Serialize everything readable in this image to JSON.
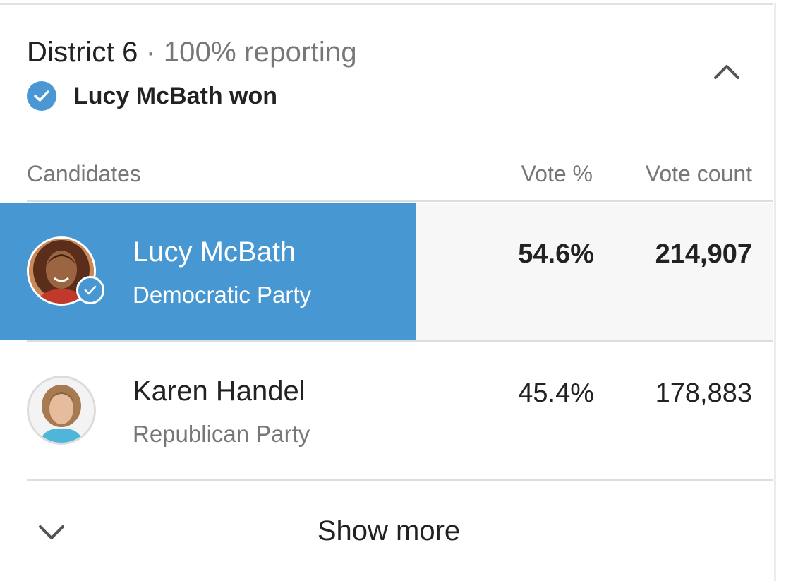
{
  "race": {
    "district": "District 6",
    "separator": " · ",
    "reporting": "100% reporting",
    "winner_text": "Lucy McBath won"
  },
  "columns": {
    "candidates": "Candidates",
    "vote_pct": "Vote %",
    "vote_count": "Vote count"
  },
  "candidates": [
    {
      "name": "Lucy McBath",
      "party": "Democratic Party",
      "vote_pct": "54.6%",
      "vote_count": "214,907",
      "winner": true
    },
    {
      "name": "Karen Handel",
      "party": "Republican Party",
      "vote_pct": "45.4%",
      "vote_count": "178,883",
      "winner": false
    }
  ],
  "footer": {
    "show_more_label": "Show more"
  },
  "icons": {
    "collapse": "chevron-up-icon",
    "expand": "chevron-down-icon",
    "winner_check": "check-circle-icon",
    "avatar": "candidate-photo"
  },
  "colors": {
    "accent": "#4697d2",
    "check_badge": "#4a97d3",
    "text_primary": "#222222",
    "text_muted": "#777777",
    "divider": "#dddddd",
    "row_highlight_bg": "#f7f7f7"
  }
}
